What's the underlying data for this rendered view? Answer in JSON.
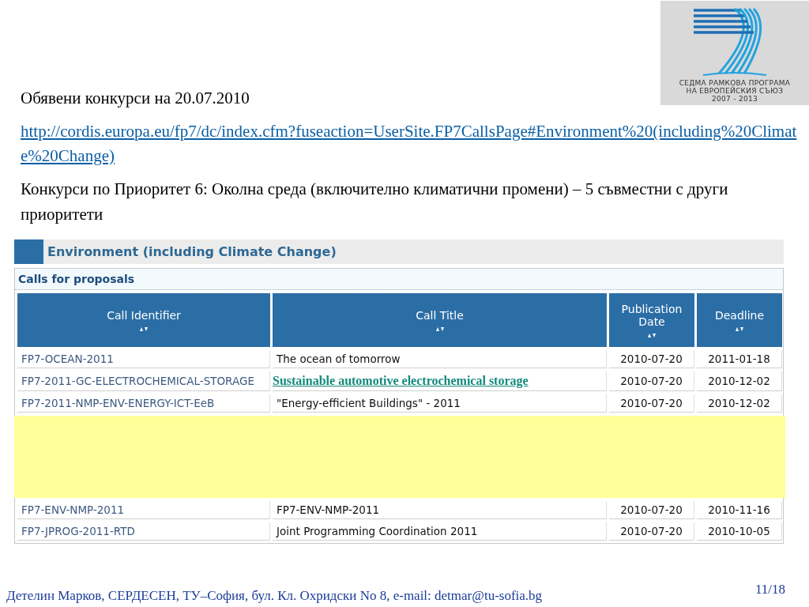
{
  "logo": {
    "lines": [
      "СЕДМА РАМКОВА ПРОГРАМА",
      "НА ЕВРОПЕЙСКИЯ СЪЮЗ",
      "2007 - 2013"
    ]
  },
  "heading": "Обявени конкурси на 20.07.2010",
  "link": "http://cordis.europa.eu/fp7/dc/index.cfm?fuseaction=UserSite.FP7CallsPage#Environment%20(including%20Climate%20Change)",
  "description": "Конкурси по Приоритет 6: Околна среда (включително климатични промени) – 5 съвместни с други приоритети",
  "web_page": {
    "section_title": "Environment (including Climate Change)",
    "subsection_title": "Calls for proposals",
    "table": {
      "columns": [
        "Call Identifier",
        "Call Title",
        "Publication Date",
        "Deadline"
      ],
      "rows": [
        {
          "kind": "plain",
          "cells": [
            "FP7-OCEAN-2011",
            "The ocean of tomorrow",
            "2010-07-20",
            "2011-01-18"
          ]
        },
        {
          "kind": "highlighted",
          "cells": [
            "FP7-2011-GC-ELECTROCHEMICAL-STORAGE",
            "Sustainable automotive electrochemical storage",
            "2010-07-20",
            "2010-12-02"
          ]
        },
        {
          "kind": "plain",
          "cells": [
            "FP7-2011-NMP-ENV-ENERGY-ICT-EeB",
            "\"Energy-efficient Buildings\" - 2011",
            "2010-07-20",
            "2010-12-02"
          ]
        },
        {
          "kind": "covered"
        },
        {
          "kind": "plain",
          "cells": [
            "FP7-ENV-NMP-2011",
            "FP7-ENV-NMP-2011",
            "2010-07-20",
            "2010-11-16"
          ]
        },
        {
          "kind": "plain",
          "cells": [
            "FP7-JPROG-2011-RTD",
            "Joint Programming Coordination 2011",
            "2010-07-20",
            "2010-10-05"
          ]
        }
      ]
    }
  },
  "footer": {
    "author": "Детелин Марков, СЕРДЕСЕН, ТУ–София, бул. Кл. Охридски No 8, e-mail: detmar@tu-sofia.bg",
    "page": "11/18"
  }
}
